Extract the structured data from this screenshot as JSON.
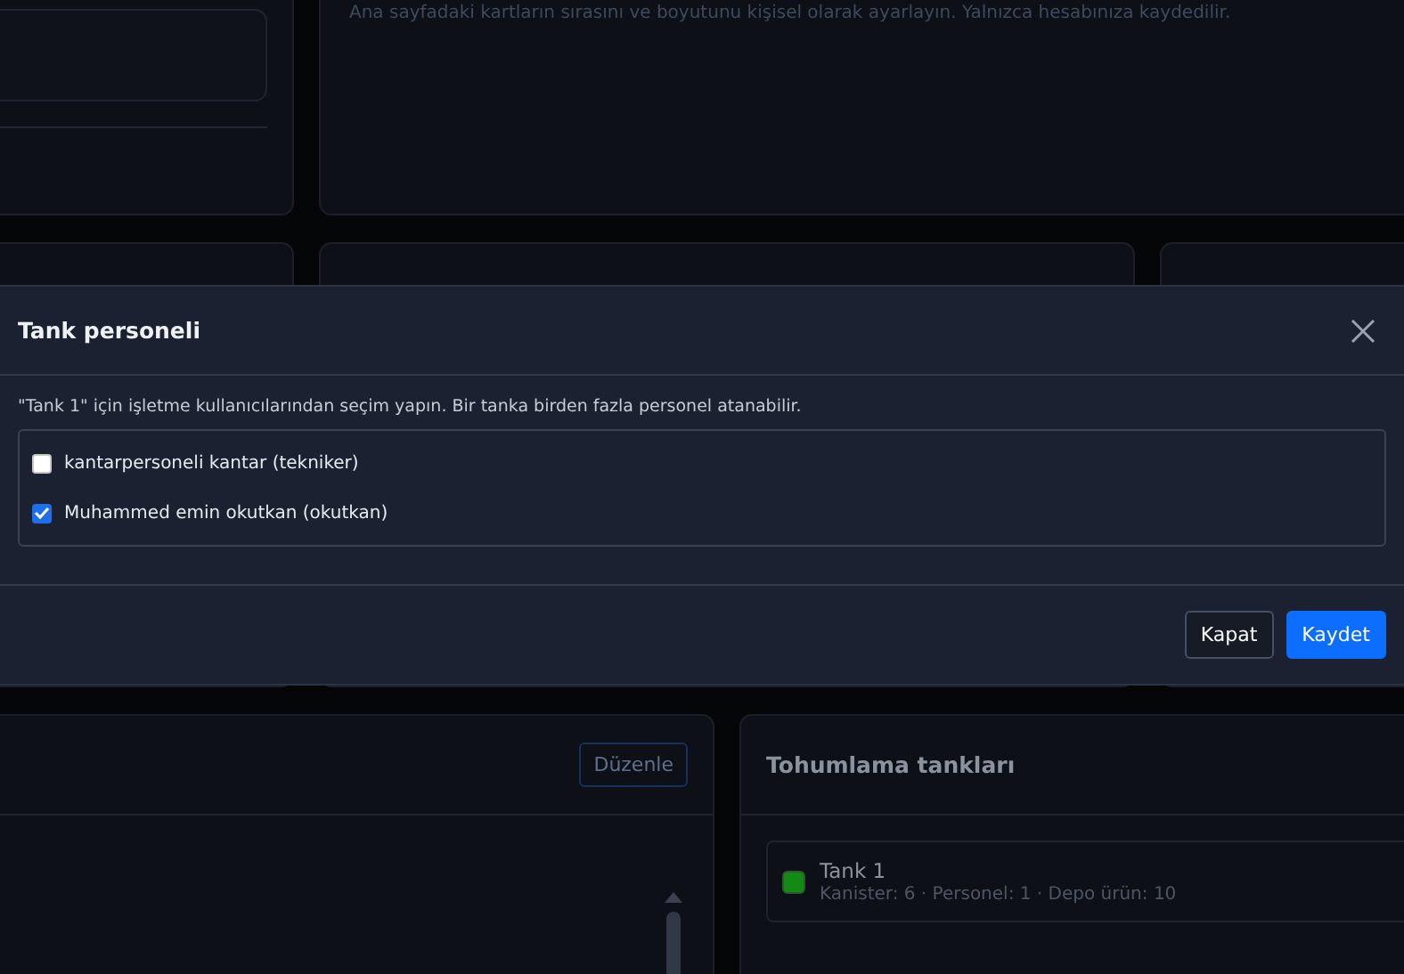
{
  "background": {
    "customize_card": {
      "description": "Ana sayfadaki kartların sırasını ve boyutunu kişisel olarak ayarlayın. Yalnızca hesabınıza kaydedilir."
    },
    "edit_button": "Düzenle",
    "tanks_card": {
      "title": "Tohumlama tankları",
      "tanks": [
        {
          "name": "Tank 1",
          "details": "Kanister: 6 · Personel: 1 · Depo ürün: 10",
          "color": "#138a13"
        }
      ]
    }
  },
  "modal": {
    "title": "Tank personeli",
    "description": "\"Tank 1\" için işletme kullanıcılarından seçim yapın. Bir tanka birden fazla personel atanabilir.",
    "users": [
      {
        "label": "kantarpersoneli kantar (tekniker)",
        "checked": false
      },
      {
        "label": "Muhammed emin okutkan (okutkan)",
        "checked": true
      }
    ],
    "buttons": [
      {
        "label": "Kapat",
        "kind": "secondary"
      },
      {
        "label": "Kaydet",
        "kind": "primary"
      }
    ]
  }
}
